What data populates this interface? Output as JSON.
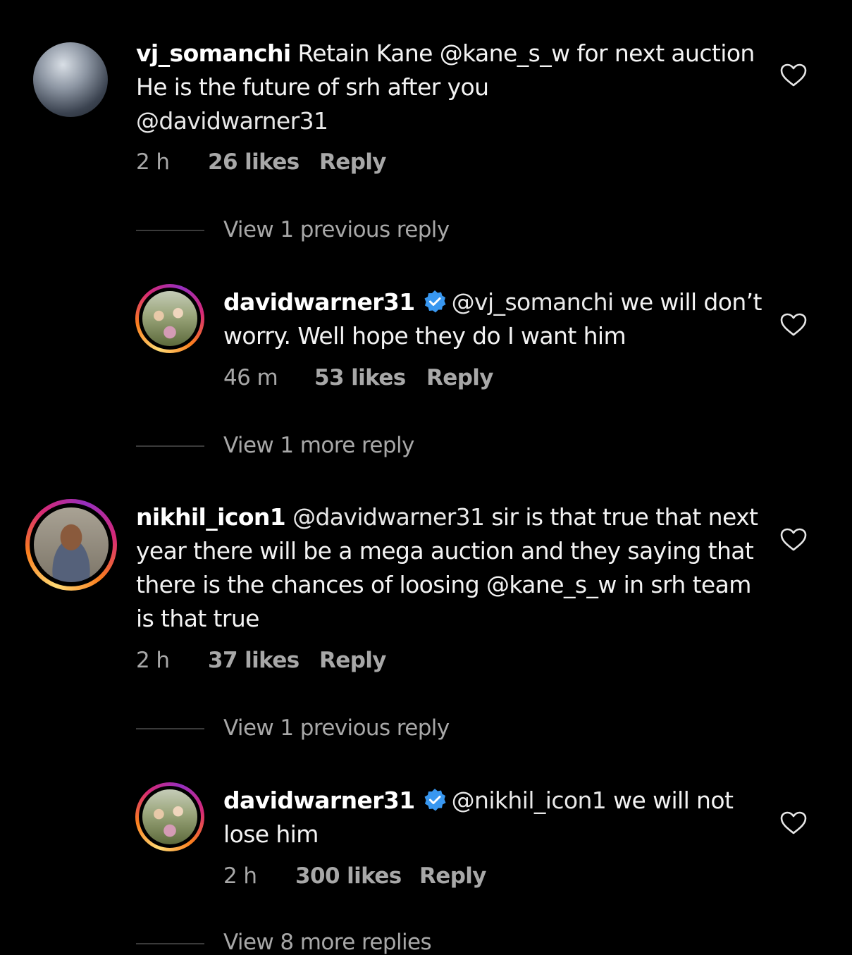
{
  "colors": {
    "background": "#000000",
    "text": "#f3f3f3",
    "meta": "#a8a8a8",
    "verified": "#3897f0"
  },
  "comments": [
    {
      "username": "vj_somanchi",
      "line1": "Retain Kane @kane_s_w for next auction",
      "line2": "He is the future of srh after you",
      "line3": " @davidwarner31",
      "time": "2 h",
      "likes": "26 likes",
      "reply": "Reply",
      "view_text": "View 1 previous reply",
      "like_icon": "heart-outline-icon"
    },
    {
      "username": "davidwarner31",
      "verified": true,
      "line1_mention": "@vj_somanchi",
      "line1_rest": " we will don’t",
      "line2": "worry. Well hope they do I want him",
      "time": "46 m",
      "likes": "53 likes",
      "reply": "Reply",
      "view_text": "View 1 more reply",
      "like_icon": "heart-outline-icon"
    },
    {
      "username": "nikhil_icon1",
      "line1_mention": "@davidwarner31",
      "line1_rest": " sir is that true that next",
      "line2": "year there will be a mega auction and they saying that",
      "line3": "there is the chances of loosing @kane_s_w in srh team",
      "line4": "is that true",
      "time": "2 h",
      "likes": "37 likes",
      "reply": "Reply",
      "view_text": "View 1 previous reply",
      "like_icon": "heart-outline-icon"
    },
    {
      "username": "davidwarner31",
      "verified": true,
      "line1_mention": "@nikhil_icon1",
      "line1_rest": " we will not",
      "line2": "lose him",
      "time": "2 h",
      "likes": "300 likes",
      "reply": "Reply",
      "view_text": "View 8 more replies",
      "like_icon": "heart-outline-icon"
    }
  ]
}
